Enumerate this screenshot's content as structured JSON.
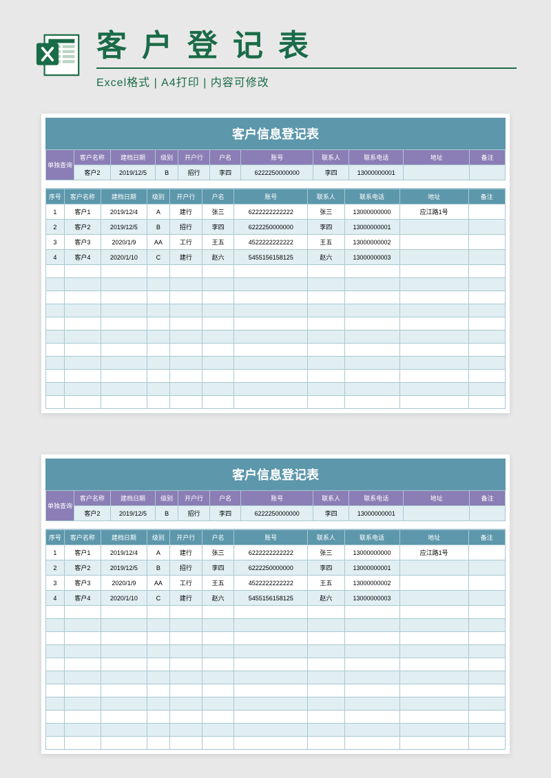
{
  "header": {
    "title": "客户登记表",
    "subtitle": "Excel格式 | A4打印 | 内容可修改"
  },
  "sheet": {
    "title": "客户信息登记表",
    "query_label": "单独查询",
    "query_headers": [
      "客户名称",
      "建档日期",
      "级别",
      "开户行",
      "户名",
      "账号",
      "联系人",
      "联系电话",
      "地址",
      "备注"
    ],
    "query_row": [
      "客户2",
      "2019/12/5",
      "B",
      "招行",
      "李四",
      "6222250000000",
      "李四",
      "13000000001",
      "",
      ""
    ],
    "list_headers": [
      "序号",
      "客户名称",
      "建档日期",
      "级别",
      "开户行",
      "户名",
      "账号",
      "联系人",
      "联系电话",
      "地址",
      "备注"
    ],
    "rows": [
      [
        "1",
        "客户1",
        "2019/12/4",
        "A",
        "建行",
        "张三",
        "6222222222222",
        "张三",
        "13000000000",
        "应江路1号",
        ""
      ],
      [
        "2",
        "客户2",
        "2019/12/5",
        "B",
        "招行",
        "李四",
        "6222250000000",
        "李四",
        "13000000001",
        "",
        ""
      ],
      [
        "3",
        "客户3",
        "2020/1/9",
        "AA",
        "工行",
        "王五",
        "4522222222222",
        "王五",
        "13000000002",
        "",
        ""
      ],
      [
        "4",
        "客户4",
        "2020/1/10",
        "C",
        "建行",
        "赵六",
        "5455156158125",
        "赵六",
        "13000000003",
        "",
        ""
      ]
    ],
    "empty_rows": 11
  }
}
